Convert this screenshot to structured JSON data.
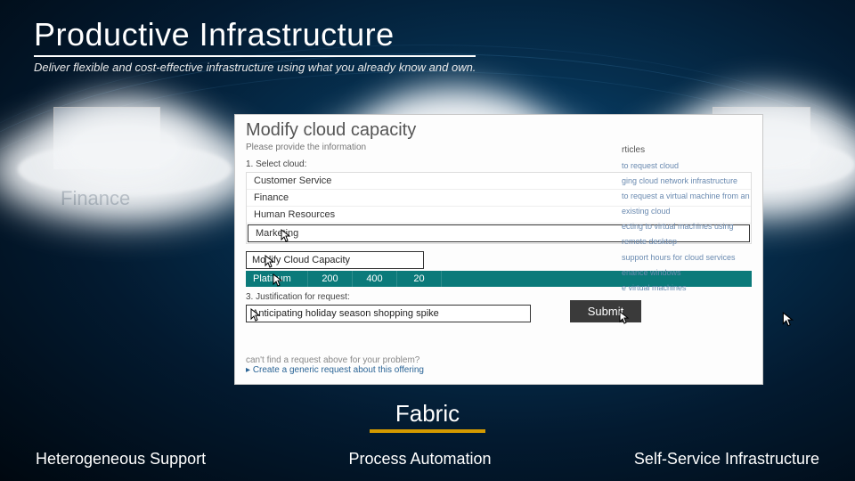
{
  "title": "Productive Infrastructure",
  "subtitle": "Deliver flexible and  cost-effective  infrastructure using what you already know and own.",
  "cloud_labels": {
    "left": "Finance",
    "mid": "Marketing"
  },
  "panel": {
    "header": "Modify cloud capacity",
    "intro": "Please provide the information",
    "step1": "1. Select cloud:",
    "step1_sub": "",
    "options": [
      "Customer Service",
      "Finance",
      "Human Resources"
    ],
    "selected": "Marketing",
    "modify_label": "Modify Cloud Capacity",
    "row": {
      "tier": "Platinum",
      "v1": "200",
      "v2": "400",
      "v3": "20"
    },
    "step3": "3. Justification for request:",
    "justification": "Anticipating holiday season shopping spike",
    "footer_q": "can't find a request above for your problem?",
    "footer_link": "Create a generic request about this offering"
  },
  "right": {
    "heading": "rticles",
    "lines": [
      "to request cloud",
      "ging cloud network infrastructure",
      "to request a virtual machine from an existing cloud",
      "ecting to virtual machines using remote desktop",
      "support hours for cloud services",
      "enance windows",
      "e virtual machines"
    ]
  },
  "submit": "Submit",
  "fabric": "Fabric",
  "bottom": {
    "left": "Heterogeneous Support",
    "mid": "Process Automation",
    "right": "Self-Service Infrastructure"
  }
}
